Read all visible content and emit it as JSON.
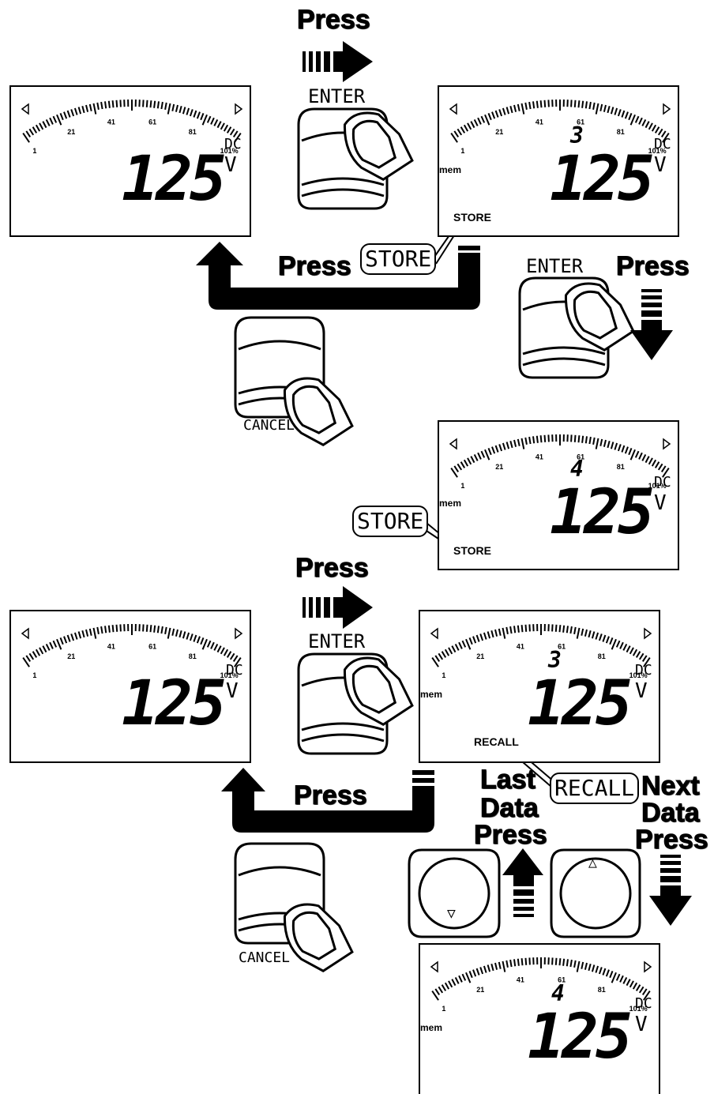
{
  "labels": {
    "press": "Press",
    "enter": "ENTER",
    "cancel": "CANCEL",
    "store": "STORE",
    "recall": "RECALL",
    "last_data_1": "Last",
    "last_data_2": "Data",
    "last_data_3": "Press",
    "next_data_1": "Next",
    "next_data_2": "Data",
    "next_data_3": "Press"
  },
  "scale": {
    "ticks": [
      "1",
      "21",
      "41",
      "61",
      "81",
      "101%"
    ]
  },
  "displays": {
    "d1": {
      "reading": "125",
      "unit_top": "DC",
      "unit_bottom": "V"
    },
    "d2": {
      "reading": "125",
      "unit_top": "DC",
      "unit_bottom": "V",
      "mem": "mem",
      "mem_no": "3",
      "flag": "STORE"
    },
    "d3": {
      "reading": "125",
      "unit_top": "DC",
      "unit_bottom": "V",
      "mem": "mem",
      "mem_no": "4",
      "flag": "STORE"
    },
    "d4": {
      "reading": "125",
      "unit_top": "DC",
      "unit_bottom": "V"
    },
    "d5": {
      "reading": "125",
      "unit_top": "DC",
      "unit_bottom": "V",
      "mem": "mem",
      "mem_no": "3",
      "flag": "RECALL"
    },
    "d6": {
      "reading": "125",
      "unit_top": "DC",
      "unit_bottom": "V",
      "mem": "mem",
      "mem_no": "4"
    }
  },
  "dial": {
    "down_symbol": "▽",
    "up_symbol": "△"
  }
}
